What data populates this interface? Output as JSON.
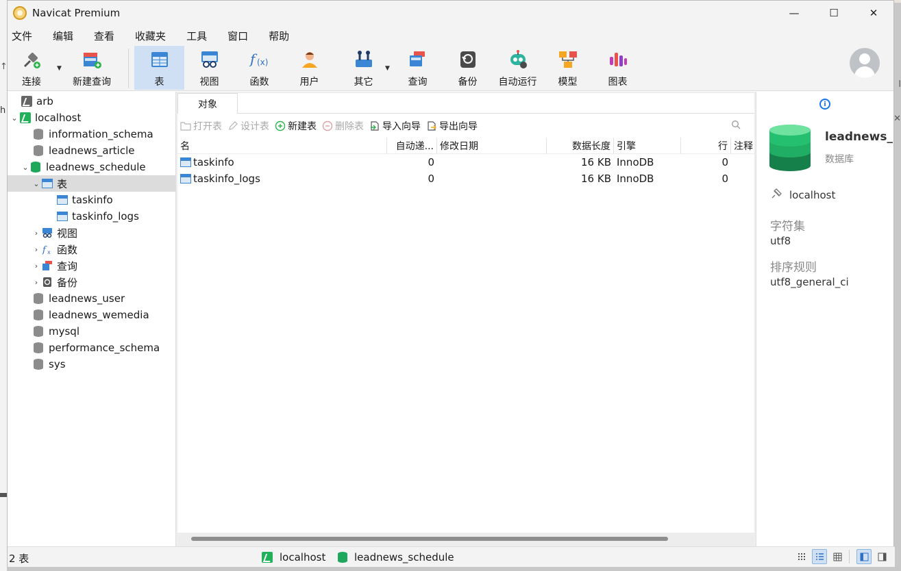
{
  "window": {
    "title": "Navicat Premium",
    "controls": {
      "minimize": "—",
      "maximize": "☐",
      "close": "✕"
    }
  },
  "menu": [
    "文件",
    "编辑",
    "查看",
    "收藏夹",
    "工具",
    "窗口",
    "帮助"
  ],
  "toolbar": [
    {
      "label": "连接",
      "icon": "connect-icon"
    },
    {
      "label": "新建查询",
      "icon": "new-query-icon"
    },
    {
      "label": "表",
      "icon": "table-icon",
      "active": true
    },
    {
      "label": "视图",
      "icon": "view-icon"
    },
    {
      "label": "函数",
      "icon": "function-icon"
    },
    {
      "label": "用户",
      "icon": "user-icon"
    },
    {
      "label": "其它",
      "icon": "other-icon"
    },
    {
      "label": "查询",
      "icon": "query-icon"
    },
    {
      "label": "备份",
      "icon": "backup-icon"
    },
    {
      "label": "自动运行",
      "icon": "automation-icon"
    },
    {
      "label": "模型",
      "icon": "model-icon"
    },
    {
      "label": "图表",
      "icon": "chart-icon"
    }
  ],
  "sidebar": {
    "tree": [
      {
        "label": "arb",
        "type": "connection"
      },
      {
        "label": "localhost",
        "type": "connection-open"
      },
      {
        "label": "information_schema",
        "type": "db"
      },
      {
        "label": "leadnews_article",
        "type": "db"
      },
      {
        "label": "leadnews_schedule",
        "type": "db-open"
      },
      {
        "label": "表",
        "type": "tables-folder"
      },
      {
        "label": "taskinfo",
        "type": "table"
      },
      {
        "label": "taskinfo_logs",
        "type": "table"
      },
      {
        "label": "视图",
        "type": "views-folder"
      },
      {
        "label": "函数",
        "type": "functions-folder"
      },
      {
        "label": "查询",
        "type": "queries-folder"
      },
      {
        "label": "备份",
        "type": "backups-folder"
      },
      {
        "label": "leadnews_user",
        "type": "db"
      },
      {
        "label": "leadnews_wemedia",
        "type": "db"
      },
      {
        "label": "mysql",
        "type": "db"
      },
      {
        "label": "performance_schema",
        "type": "db"
      },
      {
        "label": "sys",
        "type": "db"
      }
    ]
  },
  "tab": {
    "label": "对象"
  },
  "object_toolbar": {
    "open_table": "打开表",
    "design_table": "设计表",
    "new_table": "新建表",
    "delete_table": "删除表",
    "import_wizard": "导入向导",
    "export_wizard": "导出向导"
  },
  "grid": {
    "headers": {
      "name": "名",
      "auto_inc": "自动递...",
      "modified": "修改日期",
      "length": "数据长度",
      "engine": "引擎",
      "rows": "行",
      "comment": "注释"
    },
    "rows": [
      {
        "name": "taskinfo",
        "auto_inc": "0",
        "modified": "",
        "length": "16 KB",
        "engine": "InnoDB",
        "rows": "0",
        "comment": ""
      },
      {
        "name": "taskinfo_logs",
        "auto_inc": "0",
        "modified": "",
        "length": "16 KB",
        "engine": "InnoDB",
        "rows": "0",
        "comment": ""
      }
    ]
  },
  "info_panel": {
    "db_name": "leadnews_s",
    "db_type": "数据库",
    "host": "localhost",
    "charset_label": "字符集",
    "charset_value": "utf8",
    "collation_label": "排序规则",
    "collation_value": "utf8_general_ci"
  },
  "status": {
    "count": "2 表",
    "connection": "localhost",
    "database": "leadnews_schedule"
  },
  "colors": {
    "accent": "#1a73e8",
    "selected_tool": "#cfe0f4",
    "db_green": "#1fa85b",
    "table_blue": "#3a86d4"
  }
}
